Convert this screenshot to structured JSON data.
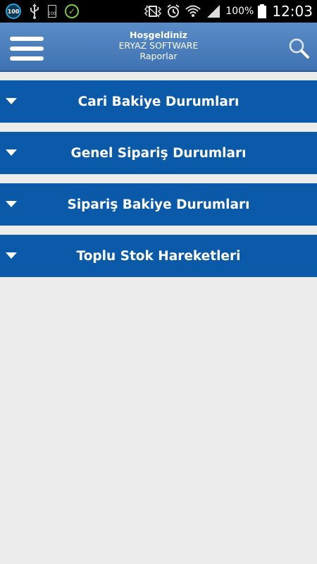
{
  "status_bar": {
    "icons": [
      "battery-100-badge-icon",
      "usb-icon",
      "battery-saver-icon",
      "check-circle-icon",
      "vibrate-icon",
      "alarm-icon",
      "wifi-icon",
      "signal-icon",
      "battery-icon"
    ],
    "badge_text": "100",
    "small_battery_text": "100",
    "battery_percent": "100%",
    "time": "12:03"
  },
  "header": {
    "line1": "Hoşgeldiniz",
    "line2": "ERYAZ SOFTWARE",
    "line3": "Raporlar",
    "menu_icon": "hamburger-menu-icon",
    "search_icon": "search-icon"
  },
  "reports": {
    "items": [
      {
        "label": "Cari Bakiye Durumları"
      },
      {
        "label": "Genel Sipariş Durumları"
      },
      {
        "label": "Sipariş Bakiye Durumları"
      },
      {
        "label": "Toplu Stok Hareketleri"
      }
    ]
  },
  "colors": {
    "header_top": "#5a8cc6",
    "header_bottom": "#3f72b2",
    "item_bg": "#0b5aaa",
    "page_bg": "#ececec"
  }
}
